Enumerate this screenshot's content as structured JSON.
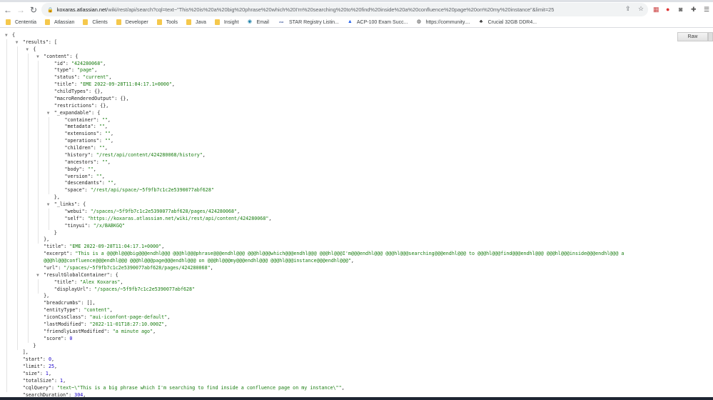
{
  "browser": {
    "url_host": "koxaras.atlassian.net",
    "url_path": "/wiki/rest/api/search?cql=text~\"This%20is%20a%20big%20phrase%20which%20I'm%20searching%20to%20find%20inside%20a%20confluence%20page%20on%20my%20instance\"&limit=25",
    "bookmarks": [
      {
        "label": "Cententia",
        "icon": "folder-icon"
      },
      {
        "label": "Atlassian",
        "icon": "folder-icon"
      },
      {
        "label": "Clients",
        "icon": "folder-icon"
      },
      {
        "label": "Developer",
        "icon": "folder-icon"
      },
      {
        "label": "Tools",
        "icon": "folder-icon"
      },
      {
        "label": "Java",
        "icon": "folder-icon"
      },
      {
        "label": "Insight",
        "icon": "folder-icon"
      },
      {
        "label": "Email",
        "icon": "email-icon"
      },
      {
        "label": "STAR Registry Listin...",
        "icon": "csa-icon"
      },
      {
        "label": "ACP-100 Exam Succ...",
        "icon": "atlassian-icon"
      },
      {
        "label": "https://community....",
        "icon": "globe-icon"
      },
      {
        "label": "Crucial 32GB DDR4...",
        "icon": "crucial-icon"
      }
    ]
  },
  "viewer": {
    "raw_label": "Raw"
  },
  "lines": [
    {
      "i": 0,
      "t": 1,
      "p": "{"
    },
    {
      "i": 1,
      "t": 1,
      "k": "results",
      "p": "["
    },
    {
      "i": 2,
      "t": 1,
      "p": "{"
    },
    {
      "i": 3,
      "t": 1,
      "k": "content",
      "p": "{"
    },
    {
      "i": 4,
      "k": "id",
      "v": "\"424280068\"",
      "vt": "str",
      "e": ","
    },
    {
      "i": 4,
      "k": "type",
      "v": "\"page\"",
      "vt": "str",
      "e": ","
    },
    {
      "i": 4,
      "k": "status",
      "v": "\"current\"",
      "vt": "str",
      "e": ","
    },
    {
      "i": 4,
      "k": "title",
      "v": "\"EME 2022-09-28T11:04:17.1+0000\"",
      "vt": "str",
      "e": ","
    },
    {
      "i": 4,
      "k": "childTypes",
      "p": "{},"
    },
    {
      "i": 4,
      "k": "macroRenderedOutput",
      "p": "{},"
    },
    {
      "i": 4,
      "k": "restrictions",
      "p": "{},"
    },
    {
      "i": 4,
      "t": 1,
      "k": "_expandable",
      "p": "{"
    },
    {
      "i": 5,
      "k": "container",
      "v": "\"\"",
      "vt": "str",
      "e": ","
    },
    {
      "i": 5,
      "k": "metadata",
      "v": "\"\"",
      "vt": "str",
      "e": ","
    },
    {
      "i": 5,
      "k": "extensions",
      "v": "\"\"",
      "vt": "str",
      "e": ","
    },
    {
      "i": 5,
      "k": "operations",
      "v": "\"\"",
      "vt": "str",
      "e": ","
    },
    {
      "i": 5,
      "k": "children",
      "v": "\"\"",
      "vt": "str",
      "e": ","
    },
    {
      "i": 5,
      "k": "history",
      "v": "\"/rest/api/content/424280068/history\"",
      "vt": "str",
      "e": ","
    },
    {
      "i": 5,
      "k": "ancestors",
      "v": "\"\"",
      "vt": "str",
      "e": ","
    },
    {
      "i": 5,
      "k": "body",
      "v": "\"\"",
      "vt": "str",
      "e": ","
    },
    {
      "i": 5,
      "k": "version",
      "v": "\"\"",
      "vt": "str",
      "e": ","
    },
    {
      "i": 5,
      "k": "descendants",
      "v": "\"\"",
      "vt": "str",
      "e": ","
    },
    {
      "i": 5,
      "k": "space",
      "v": "\"/rest/api/space/~5f9fb7c1c2e5390077abf628\"",
      "vt": "str"
    },
    {
      "i": 4,
      "p": "},"
    },
    {
      "i": 4,
      "t": 1,
      "k": "_links",
      "p": "{"
    },
    {
      "i": 5,
      "k": "webui",
      "v": "\"/spaces/~5f9fb7c1c2e5390077abf628/pages/424280068\"",
      "vt": "str",
      "e": ","
    },
    {
      "i": 5,
      "k": "self",
      "v": "\"https://koxaras.atlassian.net/wiki/rest/api/content/424280068\"",
      "vt": "str",
      "e": ","
    },
    {
      "i": 5,
      "k": "tinyui",
      "v": "\"/x/BABKGQ\"",
      "vt": "str"
    },
    {
      "i": 4,
      "p": "}"
    },
    {
      "i": 3,
      "p": "},"
    },
    {
      "i": 3,
      "k": "title",
      "v": "\"EME 2022-09-28T11:04:17.1+0000\"",
      "vt": "str",
      "e": ","
    },
    {
      "i": 3,
      "k": "excerpt",
      "v": "\"This is a @@@hl@@@big@@@endhl@@@ @@@hl@@@phrase@@@endhl@@@ @@@hl@@@which@@@endhl@@@ @@@hl@@@I'm@@@endhl@@@ @@@hl@@@searching@@@endhl@@@ to @@@hl@@@find@@@endhl@@@ @@@hl@@@inside@@@endhl@@@ a @@@hl@@@confluence@@@endhl@@@ @@@hl@@@page@@@endhl@@@ on @@@hl@@@my@@@endhl@@@ @@@hl@@@instance@@@endhl@@@\"",
      "vt": "str",
      "e": ","
    },
    {
      "i": 3,
      "k": "url",
      "v": "\"/spaces/~5f9fb7c1c2e5390077abf628/pages/424280068\"",
      "vt": "str",
      "e": ","
    },
    {
      "i": 3,
      "t": 1,
      "k": "resultGlobalContainer",
      "p": "{"
    },
    {
      "i": 4,
      "k": "title",
      "v": "\"Alex Koxaras\"",
      "vt": "str",
      "e": ","
    },
    {
      "i": 4,
      "k": "displayUrl",
      "v": "\"/spaces/~5f9fb7c1c2e5390077abf628\"",
      "vt": "str"
    },
    {
      "i": 3,
      "p": "},"
    },
    {
      "i": 3,
      "k": "breadcrumbs",
      "p": "[],"
    },
    {
      "i": 3,
      "k": "entityType",
      "v": "\"content\"",
      "vt": "str",
      "e": ","
    },
    {
      "i": 3,
      "k": "iconCssClass",
      "v": "\"aui-iconfont-page-default\"",
      "vt": "str",
      "e": ","
    },
    {
      "i": 3,
      "k": "lastModified",
      "v": "\"2022-11-01T18:27:10.000Z\"",
      "vt": "str",
      "e": ","
    },
    {
      "i": 3,
      "k": "friendlyLastModified",
      "v": "\"a minute ago\"",
      "vt": "str",
      "e": ","
    },
    {
      "i": 3,
      "k": "score",
      "v": "0",
      "vt": "num"
    },
    {
      "i": 2,
      "p": "}"
    },
    {
      "i": 1,
      "p": "],"
    },
    {
      "i": 1,
      "k": "start",
      "v": "0",
      "vt": "num",
      "e": ","
    },
    {
      "i": 1,
      "k": "limit",
      "v": "25",
      "vt": "num",
      "e": ","
    },
    {
      "i": 1,
      "k": "size",
      "v": "1",
      "vt": "num",
      "e": ","
    },
    {
      "i": 1,
      "k": "totalSize",
      "v": "1",
      "vt": "num",
      "e": ","
    },
    {
      "i": 1,
      "k": "cqlQuery",
      "v": "\"text~\\\"This is a big phrase which I'm searching to find inside a confluence page on my instance\\\"\"",
      "vt": "str",
      "e": ","
    },
    {
      "i": 1,
      "k": "searchDuration",
      "v": "304",
      "vt": "num",
      "e": ","
    }
  ]
}
